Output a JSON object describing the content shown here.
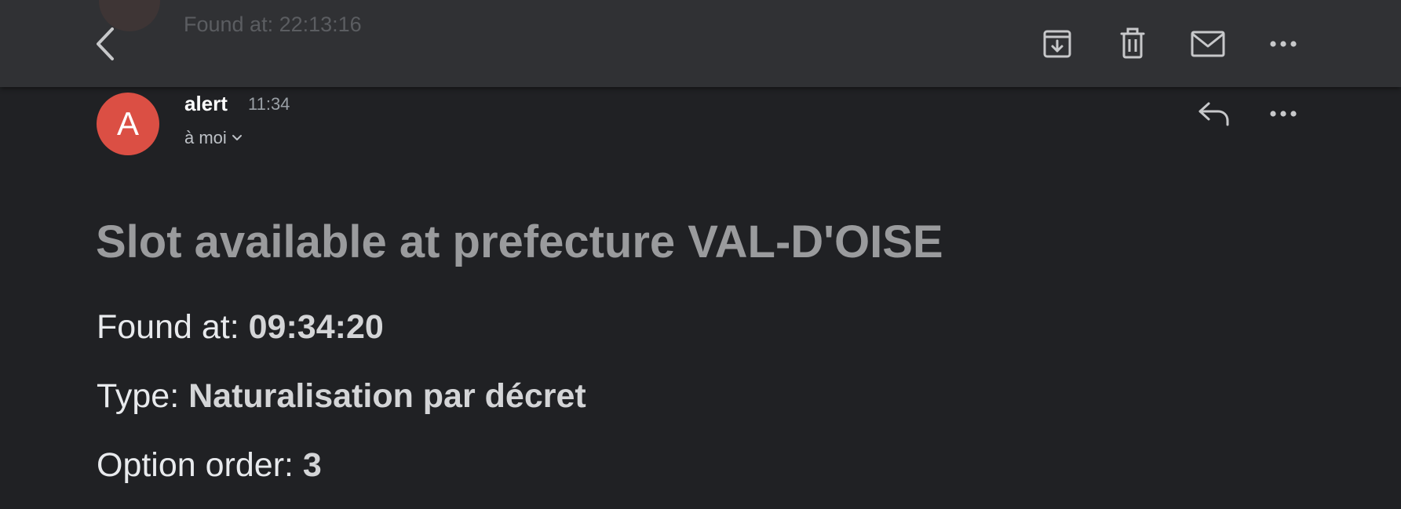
{
  "toolbar": {
    "ghost_text": "Found at: 22:13:16",
    "icons": {
      "back": "chevron-left-icon",
      "archive": "archive-icon",
      "delete": "trash-icon",
      "mark_unread": "mail-icon",
      "more": "more-horizontal-icon"
    }
  },
  "message": {
    "avatar_letter": "A",
    "avatar_color": "#db4f44",
    "sender": "alert",
    "time": "11:34",
    "recipient": "à moi",
    "icons": {
      "recipient_toggle": "chevron-down-icon",
      "reply": "reply-icon",
      "more": "more-horizontal-icon"
    }
  },
  "body": {
    "subject": "Slot available at prefecture VAL-D'OISE",
    "found_label": "Found at: ",
    "found_value": "09:34:20",
    "type_label": "Type: ",
    "type_value": "Naturalisation par décret",
    "option_label": "Option order: ",
    "option_value": "3"
  }
}
